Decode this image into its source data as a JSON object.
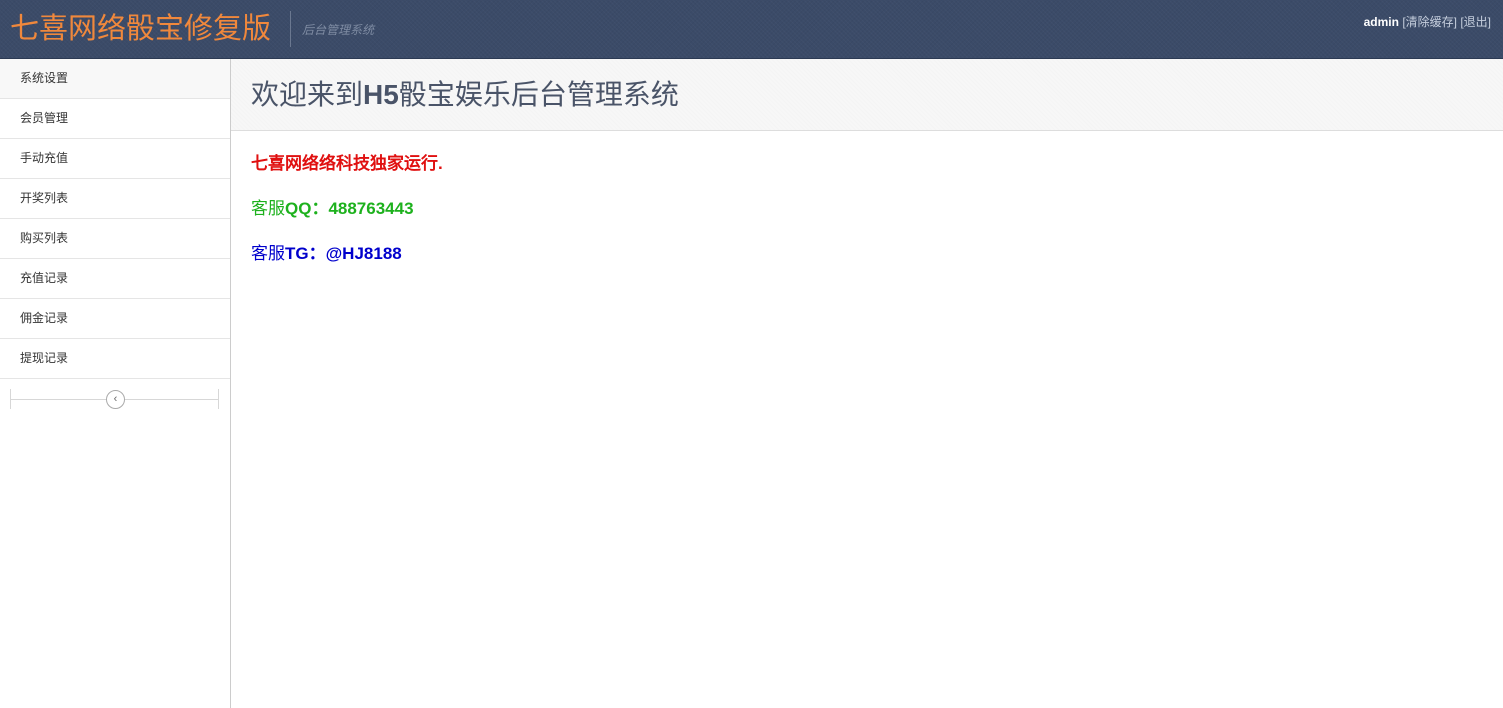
{
  "header": {
    "brand": "七喜网络骰宝修复版",
    "subtitle": "后台管理系统",
    "user": {
      "name": "admin",
      "clear_cache": "[清除缓存]",
      "logout": "[退出]"
    }
  },
  "sidebar": {
    "items": [
      {
        "label": "系统设置"
      },
      {
        "label": "会员管理"
      },
      {
        "label": "手动充值"
      },
      {
        "label": "开奖列表"
      },
      {
        "label": "购买列表"
      },
      {
        "label": "充值记录"
      },
      {
        "label": "佣金记录"
      },
      {
        "label": "提现记录"
      }
    ],
    "collapse_icon": "chevron-left-icon"
  },
  "main": {
    "title_prefix": "欢迎来到",
    "title_bold": "H5",
    "title_suffix": "骰宝娱乐后台管理系统",
    "notice": "七喜网络络科技独家运行.",
    "qq_label": "客服",
    "qq_bold": "QQ：488763443",
    "tg_label": "客服",
    "tg_bold": "TG：@HJ8188"
  },
  "colors": {
    "header_bg": "#3b4b68",
    "brand": "#f0883c",
    "notice_red": "#e01010",
    "qq_green": "#1db11d",
    "tg_blue": "#0000cc"
  }
}
